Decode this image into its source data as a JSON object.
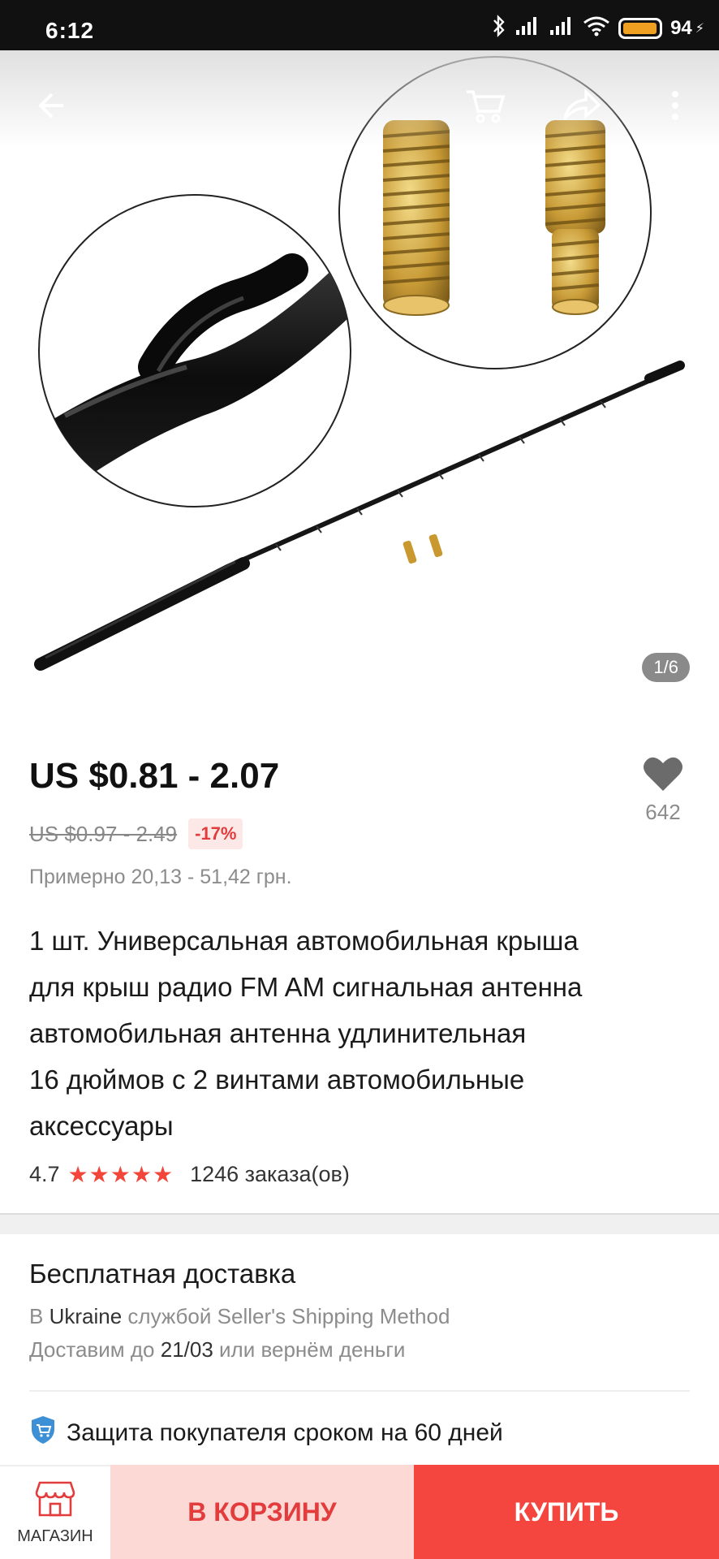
{
  "status_bar": {
    "time": "6:12",
    "battery_percent": "94",
    "icons": [
      "bluetooth-icon",
      "signal-icon",
      "signal-icon",
      "wifi-icon",
      "battery-icon"
    ]
  },
  "hero": {
    "image_counter": "1/6",
    "nav_icons": [
      "back-arrow-icon",
      "cart-icon",
      "share-icon",
      "more-vertical-icon"
    ]
  },
  "price": {
    "current": "US $0.81 - 2.07",
    "original": "US $0.97 - 2.49",
    "discount": "-17%",
    "approx": "Примерно 20,13 - 51,42 грн."
  },
  "wishlist": {
    "count": "642",
    "icon": "heart-icon"
  },
  "product": {
    "title_lines": [
      "1 шт. Универсальная автомобильная крыша",
      "для крыш радио FM AM сигнальная антенна",
      "автомобильная антенна удлинительная",
      "16 дюймов с 2 винтами автомобильные",
      "аксессуары"
    ],
    "rating": "4.7",
    "stars": "★★★★★",
    "orders": "1246 заказа(ов)"
  },
  "shipping": {
    "title": "Бесплатная доставка",
    "line1_prefix": "В ",
    "line1_country": "Ukraine",
    "line1_suffix": " службой Seller's Shipping Method",
    "line2_prefix": "Доставим до ",
    "line2_date": "21/03",
    "line2_suffix": " или вернём деньги"
  },
  "protection": {
    "text": "Защита покупателя сроком на 60 дней",
    "icon": "shield-cart-icon"
  },
  "bottom_bar": {
    "store_label": "МАГАЗИН",
    "cart_label": "В КОРЗИНУ",
    "buy_label": "КУПИТЬ"
  },
  "colors": {
    "accent": "#f4463e",
    "cart_bg": "#fdd9d6",
    "star": "#f2463a",
    "shield": "#3d8fd6"
  }
}
